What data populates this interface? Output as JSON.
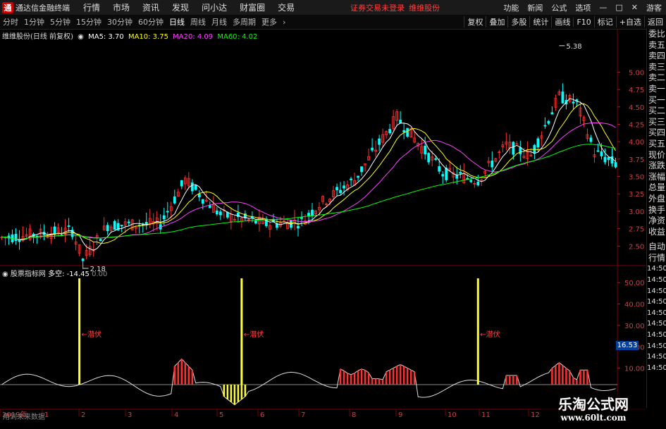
{
  "app": {
    "title": "通达信金融终端",
    "menu": [
      "行情",
      "市场",
      "资讯",
      "发现",
      "问小达",
      "财富圈",
      "交易"
    ],
    "status": "证券交易未登录",
    "status2": "维维股份",
    "right_menu": [
      "功能",
      "新闻",
      "公式",
      "选项"
    ],
    "guest": "游客",
    "logo": "通"
  },
  "toolbar": {
    "periods": [
      "分时",
      "1分钟",
      "5分钟",
      "15分钟",
      "30分钟",
      "60分钟",
      "日线",
      "周线",
      "月线",
      "多周期",
      "更多"
    ],
    "active": "日线",
    "right_buttons": [
      "复权",
      "叠加",
      "多股",
      "统计",
      "画线",
      "F10",
      "标记",
      "+自选",
      "返回"
    ]
  },
  "legend": {
    "stock": "维维股份(日线 前复权)",
    "ma5": "MA5: 3.70",
    "ma10": "MA10: 3.75",
    "ma20": "MA20: 4.09",
    "ma60": "MA60: 4.02"
  },
  "indicator_legend": {
    "name": "股票指标网",
    "label": "多空: -14.45",
    "value": "0.00"
  },
  "sidebar": [
    "委比",
    "卖五",
    "卖四",
    "卖三",
    "卖二",
    "卖一",
    "买一",
    "买二",
    "买三",
    "买四",
    "买五",
    "现价",
    "涨跌",
    "涨幅",
    "总量",
    "外盘",
    "换手",
    "净资",
    "收益"
  ],
  "sidebar_lower": [
    "自动",
    "行情",
    "14:50",
    "14:50",
    "14:50",
    "14:50",
    "14:50",
    "14:50",
    "14:50",
    "14:50",
    "14:50",
    "14:50"
  ],
  "future_note": "用到未来数据",
  "current_value": "16.53",
  "watermark": {
    "line1": "乐淘公式网",
    "line2": "www.60lt.com"
  },
  "colors": {
    "ma5": "#ffffff",
    "ma10": "#ffff00",
    "ma20": "#ff40ff",
    "ma60": "#00ff00",
    "up": "#ff3030",
    "down": "#00ffff",
    "signal": "#ffff30"
  },
  "chart_data": [
    {
      "type": "candlestick",
      "title": "维维股份(日线 前复权)",
      "ylim": [
        2.25,
        5.5
      ],
      "yticks": [
        2.5,
        2.75,
        3.0,
        3.25,
        3.5,
        3.75,
        4.0,
        4.25,
        4.5,
        4.75,
        5.0
      ],
      "annotations": [
        {
          "label": "5.38"
        },
        {
          "label": "2.18"
        }
      ],
      "series": [
        {
          "name": "MA5",
          "values": [
            3.7
          ]
        },
        {
          "name": "MA10",
          "values": [
            3.75
          ]
        },
        {
          "name": "MA20",
          "values": [
            4.09
          ]
        },
        {
          "name": "MA60",
          "values": [
            4.02
          ]
        }
      ]
    },
    {
      "type": "bar",
      "title": "股票指标网",
      "ylim": [
        0,
        55
      ],
      "yticks": [
        10.0,
        20.0,
        30.0,
        40.0,
        50.0
      ],
      "signal_label": "潜伏",
      "series": [
        {
          "name": "多空",
          "values": [
            -14.45
          ]
        }
      ],
      "xticks": [
        "2019年",
        "1",
        "2",
        "3",
        "4",
        "5",
        "6",
        "7",
        "8",
        "9",
        "10",
        "11",
        "12"
      ]
    }
  ]
}
